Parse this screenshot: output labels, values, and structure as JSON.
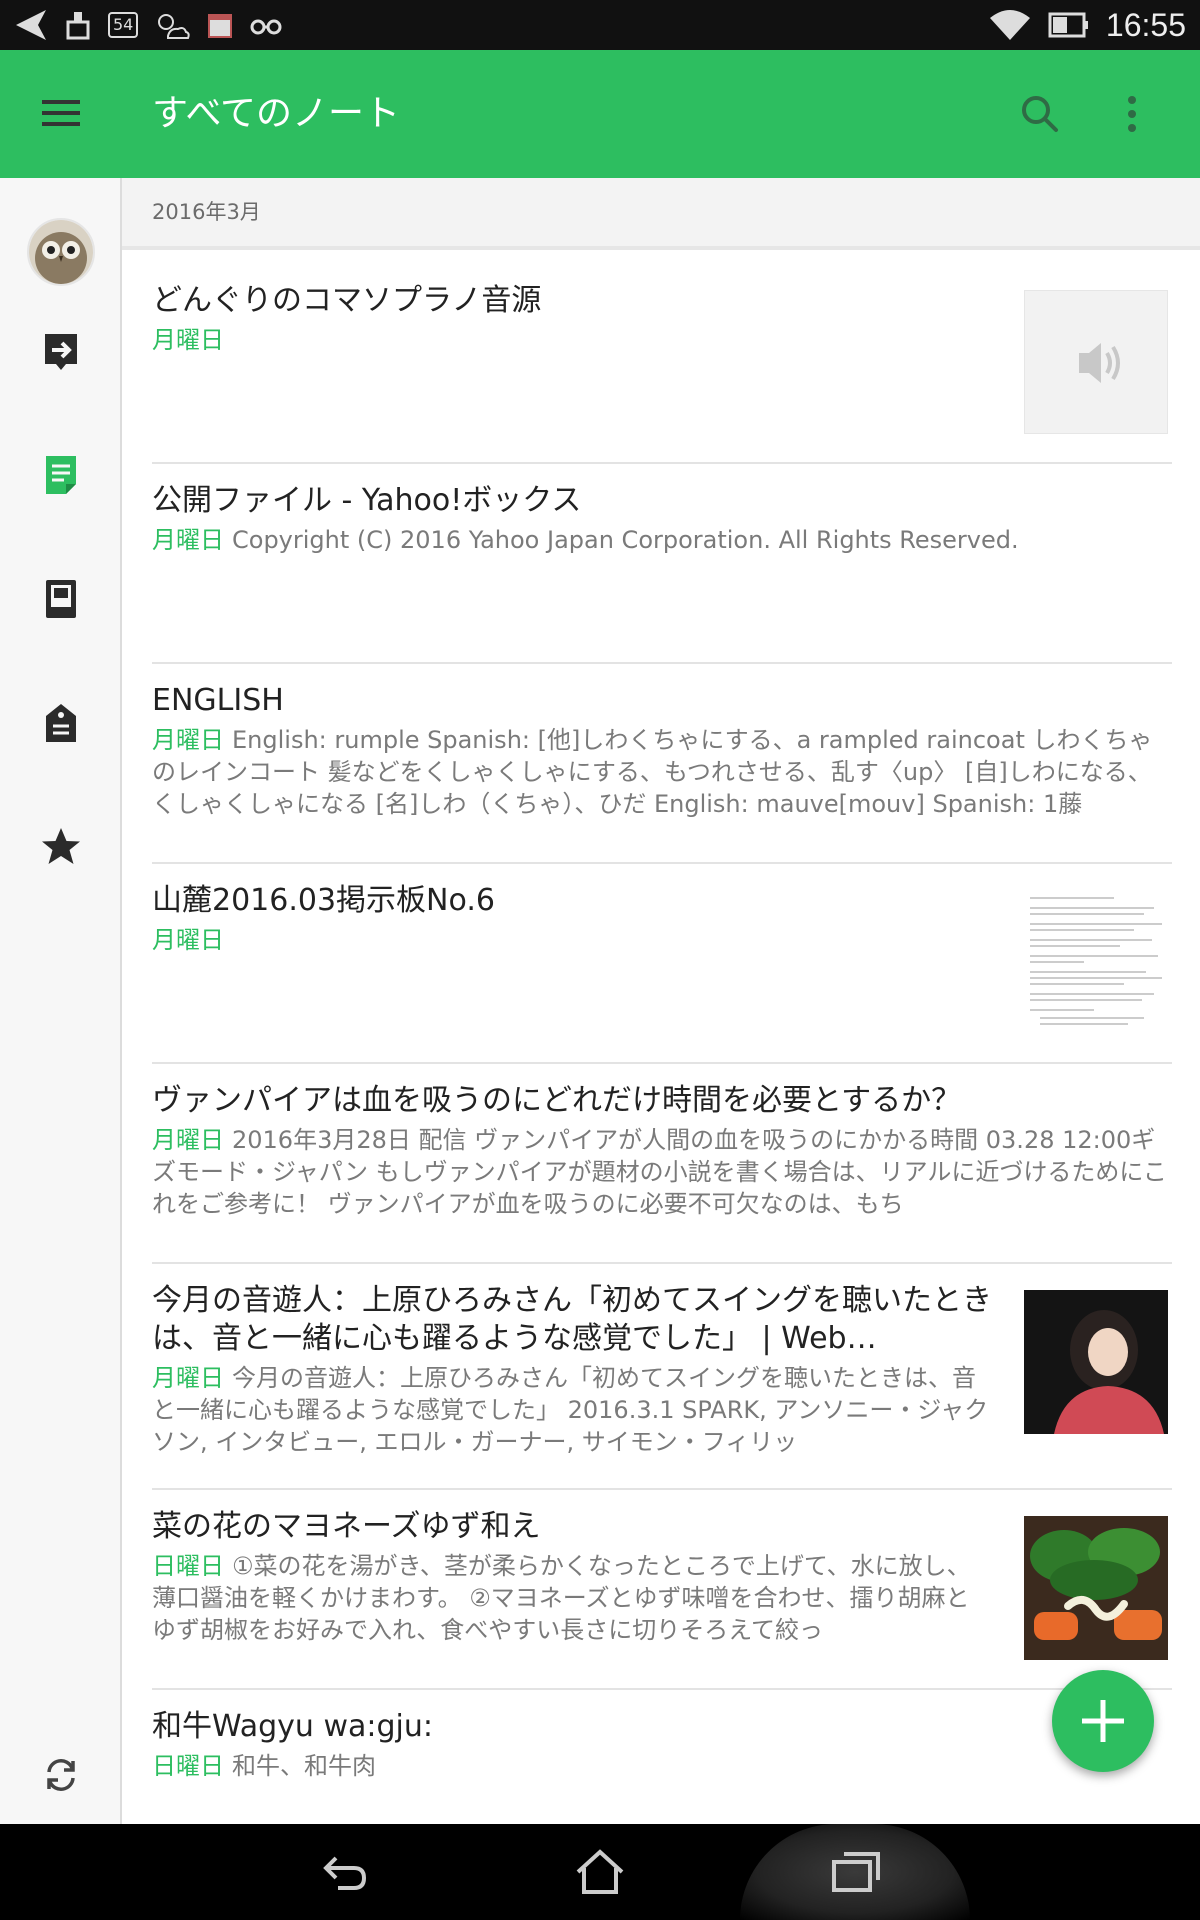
{
  "status_bar": {
    "time": "16:55",
    "badge": "54"
  },
  "app_bar": {
    "title": "すべてのノート",
    "icons": [
      "menu-icon",
      "search-icon",
      "more-vert-icon"
    ]
  },
  "section": {
    "label": "2016年3月"
  },
  "notes": [
    {
      "title": "どんぐりのコマソプラノ音源",
      "day": "月曜日",
      "snippet": "",
      "thumb": "audio"
    },
    {
      "title": "公開ファイル - Yahoo!ボックス",
      "day": "月曜日",
      "snippet": "Copyright (C) 2016 Yahoo Japan Corporation. All Rights Reserved.",
      "thumb": ""
    },
    {
      "title": "ENGLISH",
      "day": "月曜日",
      "snippet": "English: rumple Spanish: [他]しわくちゃにする、a rampled raincoat しわくちゃのレインコート 髪などをくしゃくしゃにする、もつれさせる、乱す〈up〉 [自]しわになる、くしゃくしゃになる [名]しわ（くちゃ）、ひだ English: mauve[mouv] Spanish: 1藤",
      "thumb": ""
    },
    {
      "title": "山麓2016.03掲示板No.6",
      "day": "月曜日",
      "snippet": "",
      "thumb": "document"
    },
    {
      "title": "ヴァンパイアは血を吸うのにどれだけ時間を必要とするか？",
      "day": "月曜日",
      "snippet": "2016年3月28日 配信 ヴァンパイアが人間の血を吸うのにかかる時間 03.28 12:00ギズモード・ジャパン もしヴァンパイアが題材の小説を書く場合は、リアルに近づけるためにこれをご参考に！ ヴァンパイアが血を吸うのに必要不可欠なのは、もち",
      "thumb": ""
    },
    {
      "title": "今月の音遊人：上原ひろみさん「初めてスイングを聴いたときは、音と一緒に心も躍るような感覚でした」 | Web…",
      "day": "月曜日",
      "snippet": "今月の音遊人：上原ひろみさん「初めてスイングを聴いたときは、音と一緒に心も躍るような感覚でした」 2016.3.1 SPARK, アンソニー・ジャクソン, インタビュー, エロル・ガーナー, サイモン・フィリッ",
      "thumb": "portrait"
    },
    {
      "title": "菜の花のマヨネーズゆず和え",
      "day": "日曜日",
      "snippet": "①菜の花を湯がき、茎が柔らかくなったところで上げて、水に放し、薄口醤油を軽くかけまわす。 ②マヨネーズとゆず味噌を合わせ、擂り胡麻とゆず胡椒をお好みで入れ、食べやすい長さに切りそろえて絞っ",
      "thumb": "food"
    },
    {
      "title": "和牛Wagyu wa:gju:",
      "day": "日曜日",
      "snippet": "和牛、和牛肉",
      "thumb": ""
    }
  ],
  "rail": {
    "icons": [
      "avatar",
      "shortcut-icon",
      "note-icon",
      "notebook-icon",
      "tag-icon",
      "star-icon",
      "sync-icon"
    ]
  },
  "colors": {
    "accent": "#2dbe60",
    "appbar": "#2dbe60",
    "status_bar": "#111111"
  }
}
